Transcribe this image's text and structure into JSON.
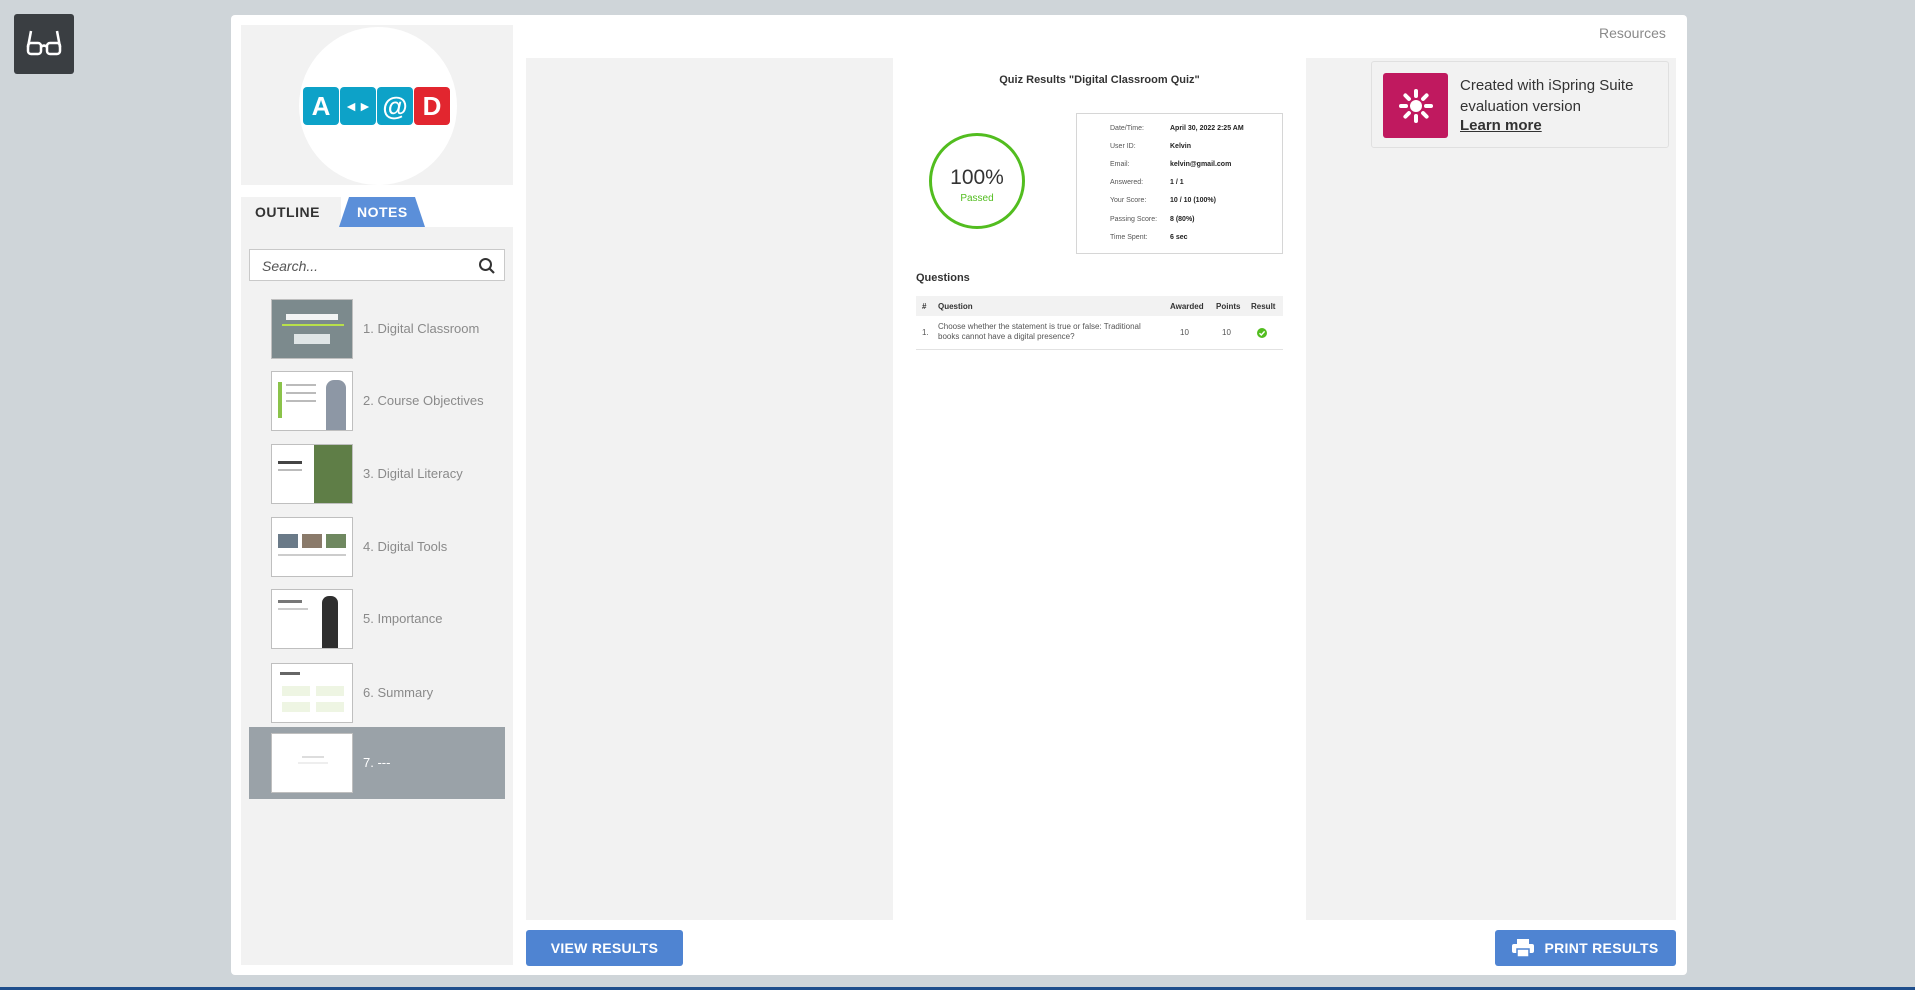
{
  "sidebar": {
    "logo_letters": [
      "A",
      "◄►",
      "@",
      "D"
    ],
    "logo_letter_colors": [
      "#0da2c8",
      "#0da2c8",
      "#0da2c8",
      "#e2262f"
    ],
    "logo_subtitle": "",
    "tabs": {
      "outline": "OUTLINE",
      "notes": "NOTES"
    },
    "search_placeholder": "Search...",
    "slides": [
      {
        "label": "1. Digital Classroom"
      },
      {
        "label": "2. Course Objectives"
      },
      {
        "label": "3. Digital Literacy"
      },
      {
        "label": "4. Digital Tools"
      },
      {
        "label": "5. Importance"
      },
      {
        "label": "6. Summary"
      },
      {
        "label": "7. ---"
      }
    ],
    "active_slide": 7
  },
  "header": {
    "resources": "Resources"
  },
  "quiz": {
    "title": "Quiz Results \"Digital Classroom Quiz\"",
    "score_percent": "100%",
    "status": "Passed",
    "details": [
      {
        "label": "Date/Time:",
        "value": "April 30, 2022 2:25 AM"
      },
      {
        "label": "User ID:",
        "value": "Kelvin"
      },
      {
        "label": "Email:",
        "value": "kelvin@gmail.com"
      },
      {
        "label": "Answered:",
        "value": "1 / 1"
      },
      {
        "label": "Your Score:",
        "value": "10 / 10 (100%)"
      },
      {
        "label": "Passing Score:",
        "value": "8 (80%)"
      },
      {
        "label": "Time Spent:",
        "value": "6 sec"
      }
    ],
    "questions_heading": "Questions",
    "columns": [
      "#",
      "Question",
      "Awarded",
      "Points",
      "Result"
    ],
    "rows": [
      {
        "num": "1.",
        "question": "Choose whether the statement is true or false: Traditional books cannot have a digital presence?",
        "awarded": "10",
        "points": "10",
        "result": "correct"
      }
    ]
  },
  "ispring": {
    "text": "Created with iSpring Suite evaluation version",
    "link": "Learn more"
  },
  "buttons": {
    "view_results": "VIEW RESULTS",
    "print_results": "PRINT RESULTS"
  },
  "colors": {
    "accent": "#4f84d2",
    "pass_green": "#52bd1f",
    "ispring_brand": "#c0195f",
    "active_slide_bg": "#9aa2a8"
  }
}
